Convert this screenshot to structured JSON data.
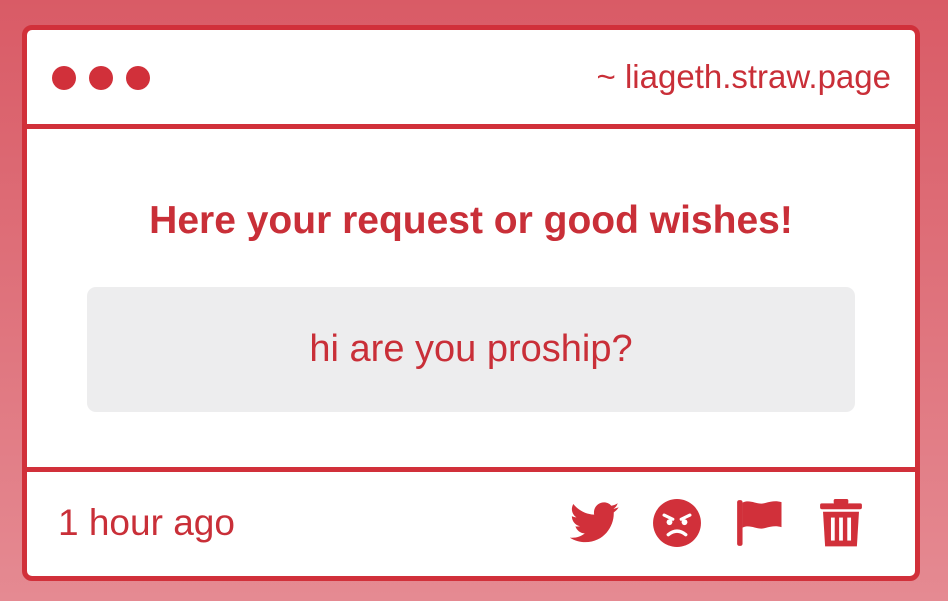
{
  "header": {
    "url": "~ liageth.straw.page"
  },
  "main": {
    "heading": "Here your request or good wishes!",
    "message": "hi are you proship?"
  },
  "footer": {
    "timestamp": "1 hour ago",
    "actions": [
      "twitter-icon",
      "angry-face-icon",
      "flag-icon",
      "trash-icon"
    ]
  },
  "colors": {
    "accent": "#d1303a",
    "text": "#c92f38",
    "message_bg": "#ededee",
    "page_bg_top": "#d95b66",
    "page_bg_bottom": "#e58a92"
  }
}
